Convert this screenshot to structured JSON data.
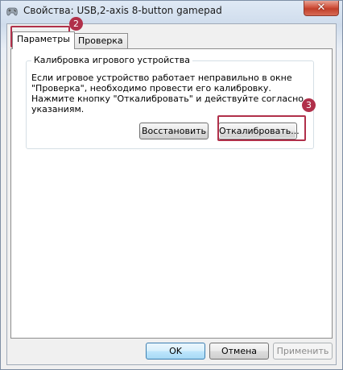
{
  "window": {
    "title": "Свойства: USB,2-axis 8-button gamepad",
    "close_label": "✕",
    "icon": "gamepad-icon"
  },
  "tabs": [
    {
      "label": "Параметры",
      "active": true
    },
    {
      "label": "Проверка",
      "active": false
    }
  ],
  "calibration_group": {
    "title": "Калибровка игрового устройства",
    "description": "Если игровое устройство работает неправильно в окне \"Проверка\", необходимо провести его калибровку. Нажмите кнопку \"Откалибровать\" и действуйте согласно указаниям.",
    "restore_label": "Восстановить",
    "calibrate_label": "Откалибровать..."
  },
  "footer": {
    "ok_label": "OK",
    "cancel_label": "Отмена",
    "apply_label": "Применить"
  },
  "annotations": {
    "step_tab": "2",
    "step_button": "3",
    "color": "#b0304a"
  }
}
